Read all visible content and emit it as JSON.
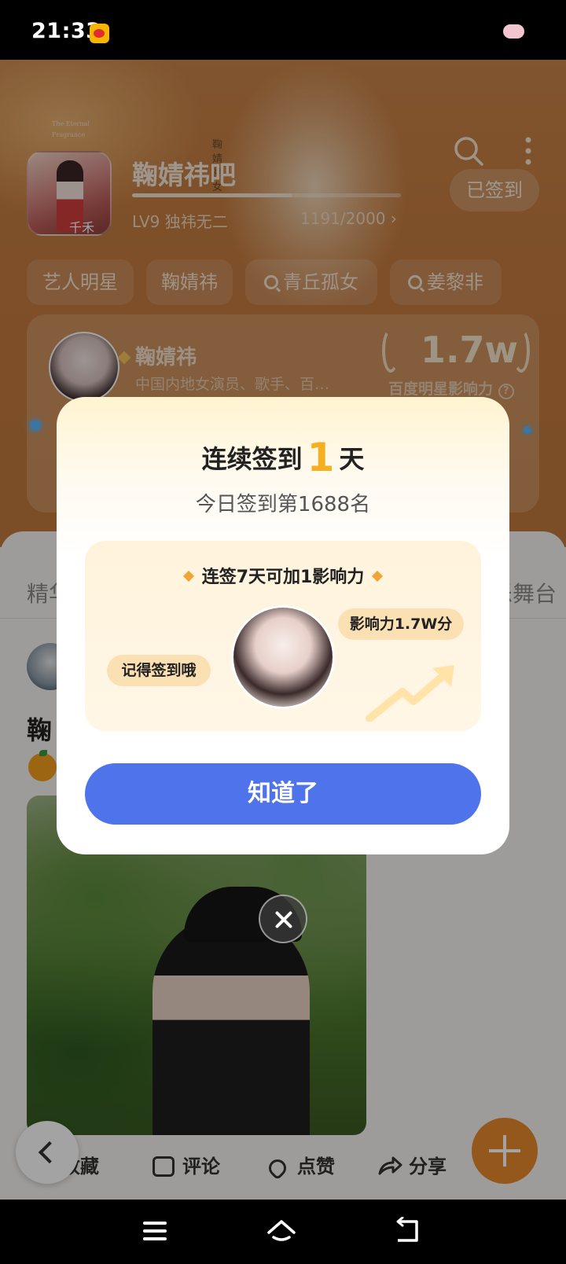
{
  "status": {
    "time": "21:33"
  },
  "header": {
    "poster_line1": "The Eternal",
    "poster_line2": "Fragrance",
    "vertical_text": "鞠婧祎女",
    "forum_title": "鞠婧祎吧",
    "level": "LV9 独祎无二",
    "level_progress": "1191/2000",
    "level_progress_fraction": 0.5955,
    "signed_label": "已签到",
    "poster_caption": "千禾"
  },
  "tags": [
    "艺人明星",
    "鞠婧祎",
    "青丘孤女",
    "姜黎非"
  ],
  "star": {
    "name": "鞠婧祎",
    "description": "中国内地女演员、歌手、百…",
    "fame_value": "1.7w",
    "fame_label": "百度明星影响力"
  },
  "tabs": {
    "left_partial": "精华",
    "right_partial": "音乐舞台"
  },
  "post": {
    "title_partial": "鞠"
  },
  "actions": {
    "collect": "收藏",
    "comment": "评论",
    "like": "点赞",
    "share": "分享"
  },
  "modal": {
    "title_prefix": "连续签到",
    "days": "1",
    "title_suffix": "天",
    "subtitle": "今日签到第1688名",
    "card_title": "连签7天可加1影响力",
    "bubble_left": "记得签到哦",
    "bubble_right": "影响力1.7W分",
    "button_label": "知道了"
  },
  "colors": {
    "accent": "#4f73ea",
    "brand_orange": "#e98a2c",
    "streak_number": "#f5b021"
  }
}
